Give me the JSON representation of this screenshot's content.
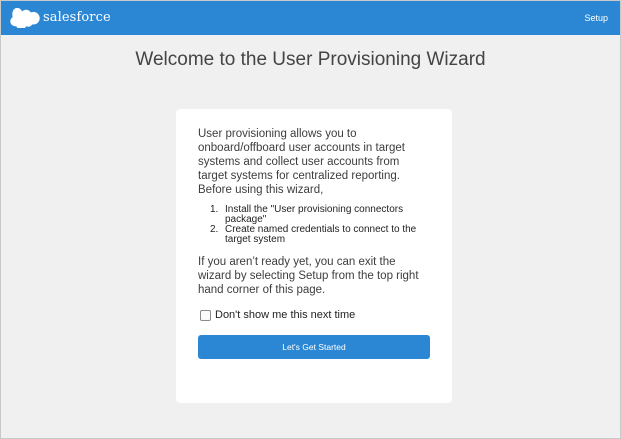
{
  "header": {
    "brand_name": "salesforce",
    "setup_link": "Setup",
    "bar_color": "#2b87d3",
    "logo_icon": "salesforce-cloud-icon"
  },
  "main": {
    "title": "Welcome to the User Provisioning Wizard"
  },
  "card": {
    "intro": "User provisioning allows you to onboard/offboard user accounts in target systems and collect user accounts from target systems for centralized reporting. Before using this wizard,",
    "steps": [
      {
        "number": "1.",
        "text": "Install the \"User provisioning connectors package\""
      },
      {
        "number": "2.",
        "text": "Create named credentials to connect to the target system"
      }
    ],
    "outro": "If you aren’t ready yet, you can exit the wizard by selecting Setup from the top right hand corner of this page.",
    "checkbox_label": "Don't show me this next time",
    "checkbox_checked": false,
    "button_label": "Let's Get Started",
    "button_color": "#2b87d3"
  }
}
